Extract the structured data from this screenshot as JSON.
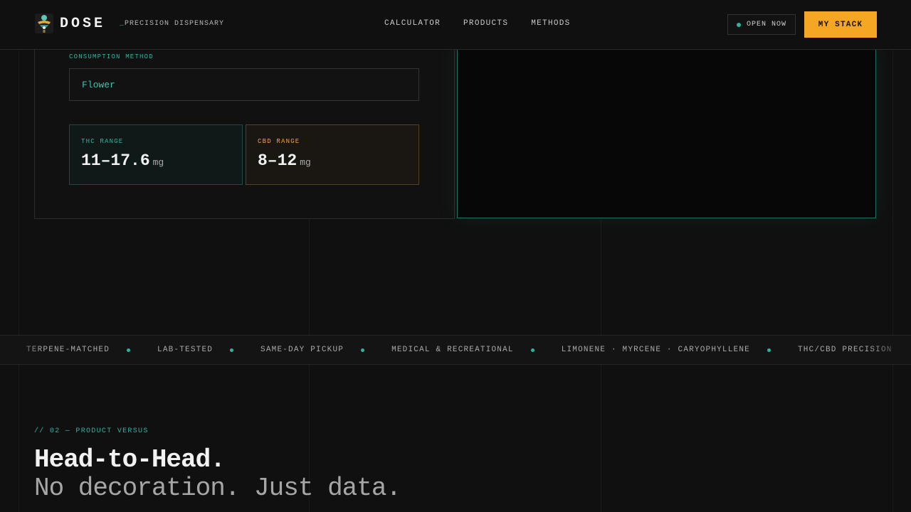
{
  "nav": {
    "brand": "DOSE",
    "tagline_prefix": "_",
    "tagline": "PRECISION DISPENSARY",
    "links": [
      "CALCULATOR",
      "PRODUCTS",
      "METHODS"
    ],
    "status": "OPEN NOW",
    "cta": "MY STACK"
  },
  "calculator": {
    "method_label": "CONSUMPTION METHOD",
    "method_value": "Flower",
    "thc": {
      "label": "THC RANGE",
      "value": "11–17.6",
      "unit": "mg"
    },
    "cbd": {
      "label": "CBD RANGE",
      "value": "8–12",
      "unit": "mg"
    }
  },
  "ticker": {
    "items": [
      "TERPENE-MATCHED",
      "LAB-TESTED",
      "SAME-DAY PICKUP",
      "MEDICAL & RECREATIONAL",
      "LIMONENE · MYRCENE · CARYOPHYLLENE",
      "THC/CBD PRECISION"
    ]
  },
  "section": {
    "label": "// 02 — PRODUCT VERSUS",
    "title": "Head-to-Head.",
    "subtitle": "No decoration. Just data."
  },
  "colors": {
    "accent_teal": "#2fb39f",
    "accent_orange": "#f5a623",
    "background": "#101010"
  },
  "icons": {
    "logo": "flower-crest-icon",
    "status": "status-dot-icon",
    "separator": "ticker-dot-icon"
  }
}
